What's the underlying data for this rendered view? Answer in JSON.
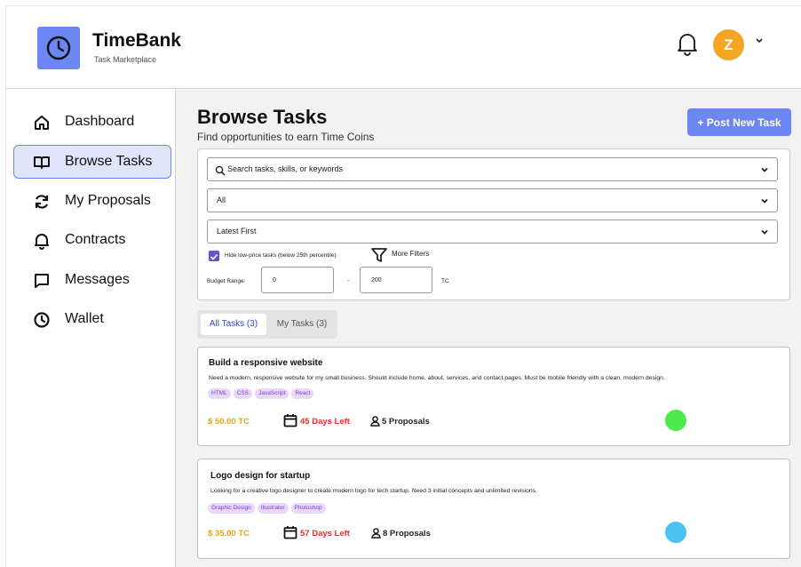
{
  "brand": {
    "title": "TimeBank",
    "subtitle": "Task Marketplace"
  },
  "user": {
    "initial": "Z",
    "avatar_color": "#f5a524"
  },
  "colors": {
    "accent": "#6c86f4",
    "price": "#e8a513",
    "deadline": "#e0302f",
    "tag_bg": "#e9d8fb",
    "tag_text": "#7a3fc4"
  },
  "sidebar": {
    "items": [
      {
        "label": "Dashboard",
        "icon": "home-icon",
        "active": false
      },
      {
        "label": "Browse Tasks",
        "icon": "book-icon",
        "active": true
      },
      {
        "label": "My Proposals",
        "icon": "refresh-icon",
        "active": false
      },
      {
        "label": "Contracts",
        "icon": "bell-icon",
        "active": false
      },
      {
        "label": "Messages",
        "icon": "message-icon",
        "active": false
      },
      {
        "label": "Wallet",
        "icon": "clock-icon",
        "active": false
      }
    ]
  },
  "main": {
    "title": "Browse Tasks",
    "subtitle": "Find opportunities to earn Time Coins",
    "post_button": "+ Post New Task"
  },
  "filters": {
    "search_placeholder": "Search tasks, skills, or keywords",
    "category": "All",
    "sort": "Latest First",
    "hide_low_price_label": "Hide low-price tasks (below 25th percentile)",
    "hide_low_price_checked": true,
    "more_filters": "More Filters",
    "budget_label": "Budget Range:",
    "budget_min": "0",
    "budget_dash": "-",
    "budget_max": "200",
    "budget_unit": "TC"
  },
  "tabs": [
    {
      "label": "All Tasks (3)",
      "active": true
    },
    {
      "label": "My Tasks (3)",
      "active": false
    }
  ],
  "tasks": [
    {
      "title": "Build a responsive website",
      "description": "Need a modern, responsive website for my small business. Should include home, about, services, and contact pages. Must be mobile friendly with a clean, modern design.",
      "tags": [
        "HTML",
        "CSS",
        "JavaScript",
        "React"
      ],
      "price": "$ 50.00 TC",
      "deadline": "45 Days Left",
      "proposals": "5 Proposals",
      "dot_color": "#4eea4c"
    },
    {
      "title": "Logo design for startup",
      "description": "Looking for a creative logo designer to create modern logo for tech startup. Need 3 initial concepts and unlimited revisions.",
      "tags": [
        "Graphic Design",
        "Illustrator",
        "Photoshop"
      ],
      "price": "$ 35.00 TC",
      "deadline": "57 Days Left",
      "proposals": "8 Proposals",
      "dot_color": "#4cc2f2"
    }
  ]
}
